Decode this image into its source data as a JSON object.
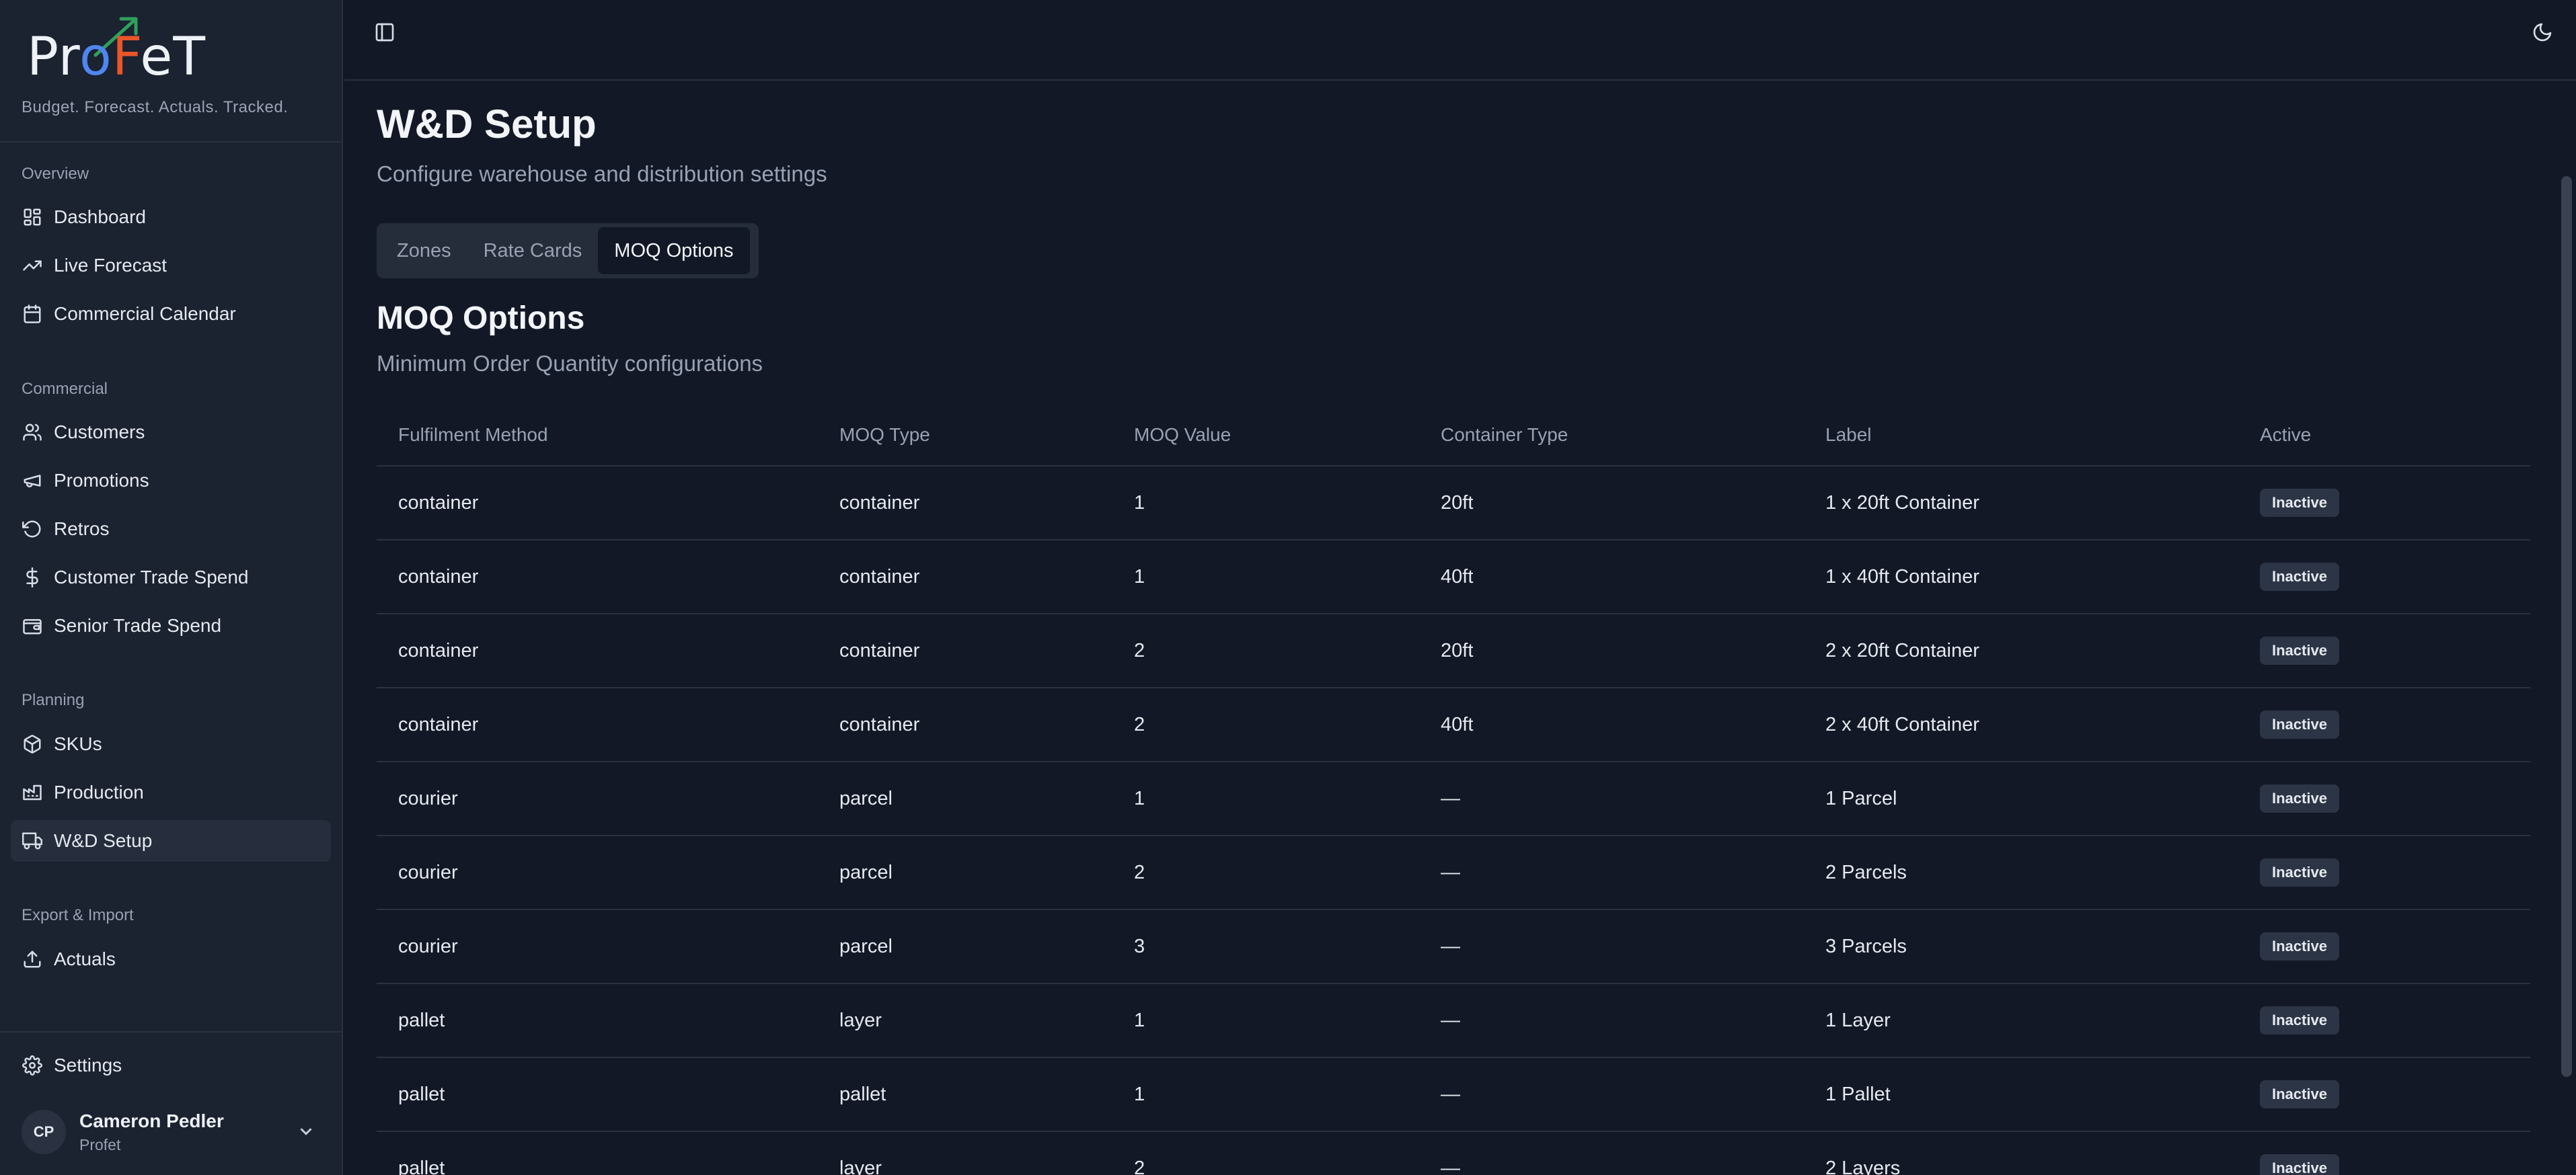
{
  "brand": {
    "logo_text": "ProFeT",
    "tagline": "Budget. Forecast. Actuals. Tracked."
  },
  "sidebar": {
    "sections": [
      {
        "label": "Overview",
        "items": [
          {
            "label": "Dashboard",
            "icon": "dashboard-icon"
          },
          {
            "label": "Live Forecast",
            "icon": "trending-up-icon"
          },
          {
            "label": "Commercial Calendar",
            "icon": "calendar-icon"
          }
        ]
      },
      {
        "label": "Commercial",
        "items": [
          {
            "label": "Customers",
            "icon": "users-icon"
          },
          {
            "label": "Promotions",
            "icon": "megaphone-icon"
          },
          {
            "label": "Retros",
            "icon": "rotate-ccw-icon"
          },
          {
            "label": "Customer Trade Spend",
            "icon": "dollar-icon"
          },
          {
            "label": "Senior Trade Spend",
            "icon": "wallet-icon"
          }
        ]
      },
      {
        "label": "Planning",
        "items": [
          {
            "label": "SKUs",
            "icon": "box-icon"
          },
          {
            "label": "Production",
            "icon": "factory-icon"
          },
          {
            "label": "W&D Setup",
            "icon": "truck-icon",
            "active": true
          }
        ]
      },
      {
        "label": "Export & Import",
        "items": [
          {
            "label": "Actuals",
            "icon": "upload-icon"
          }
        ]
      }
    ],
    "settings_label": "Settings",
    "user": {
      "initials": "CP",
      "name": "Cameron Pedler",
      "org": "Profet"
    }
  },
  "main": {
    "title": "W&D Setup",
    "subtitle": "Configure warehouse and distribution settings",
    "tabs": [
      {
        "label": "Zones"
      },
      {
        "label": "Rate Cards"
      },
      {
        "label": "MOQ Options",
        "active": true
      }
    ],
    "section_title": "MOQ Options",
    "section_subtitle": "Minimum Order Quantity configurations",
    "table": {
      "headers": [
        "Fulfilment Method",
        "MOQ Type",
        "MOQ Value",
        "Container Type",
        "Label",
        "Active"
      ],
      "rows": [
        [
          "container",
          "container",
          "1",
          "20ft",
          "1 x 20ft Container",
          "Inactive"
        ],
        [
          "container",
          "container",
          "1",
          "40ft",
          "1 x 40ft Container",
          "Inactive"
        ],
        [
          "container",
          "container",
          "2",
          "20ft",
          "2 x 20ft Container",
          "Inactive"
        ],
        [
          "container",
          "container",
          "2",
          "40ft",
          "2 x 40ft Container",
          "Inactive"
        ],
        [
          "courier",
          "parcel",
          "1",
          "—",
          "1 Parcel",
          "Inactive"
        ],
        [
          "courier",
          "parcel",
          "2",
          "—",
          "2 Parcels",
          "Inactive"
        ],
        [
          "courier",
          "parcel",
          "3",
          "—",
          "3 Parcels",
          "Inactive"
        ],
        [
          "pallet",
          "layer",
          "1",
          "—",
          "1 Layer",
          "Inactive"
        ],
        [
          "pallet",
          "pallet",
          "1",
          "—",
          "1 Pallet",
          "Inactive"
        ],
        [
          "pallet",
          "layer",
          "2",
          "—",
          "2 Layers",
          "Inactive"
        ]
      ]
    }
  },
  "colors": {
    "background": "#121826",
    "sidebar": "#1b2230",
    "accent_blue": "#4f86f0",
    "accent_orange": "#e8562a",
    "badge": "#2c3546"
  }
}
